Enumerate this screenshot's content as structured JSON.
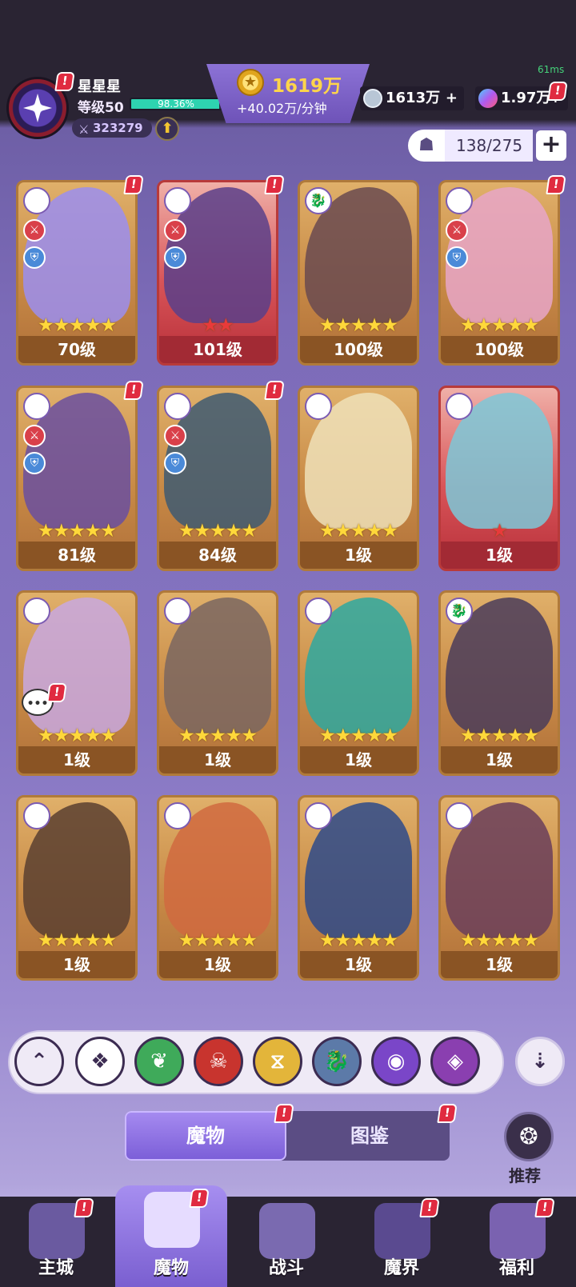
{
  "player": {
    "name": "星星星",
    "level_label": "等级50",
    "xp_percent": "98.36%",
    "xp_fraction": 0.9836,
    "power": "323279"
  },
  "gold": {
    "value": "1619万",
    "rate": "+40.02万/分钟"
  },
  "silver": {
    "value": "1613万",
    "plus": "+"
  },
  "gem": {
    "value": "1.97万",
    "plus": "+"
  },
  "ping": "61ms",
  "capacity": {
    "text": "138/275",
    "plus": "+"
  },
  "badge": "!",
  "cards": [
    {
      "level": "70级",
      "stars": "★★★★★",
      "faction": "◈",
      "frame": "gold",
      "art": "#9b8ef0"
    },
    {
      "level": "101级",
      "stars": "★★",
      "faction": "⧖",
      "frame": "red",
      "art": "#5a3f8a"
    },
    {
      "level": "100级",
      "stars": "★★★★★",
      "faction": "🐉",
      "frame": "gold",
      "art": "#6a4a50"
    },
    {
      "level": "100级",
      "stars": "★★★★★",
      "faction": "◉",
      "frame": "gold",
      "art": "#e7a6c8"
    },
    {
      "level": "81级",
      "stars": "★★★★★",
      "faction": "◉",
      "frame": "gold",
      "art": "#6a4fa0"
    },
    {
      "level": "84级",
      "stars": "★★★★★",
      "faction": "❦",
      "frame": "gold",
      "art": "#3e5a72"
    },
    {
      "level": "1级",
      "stars": "★★★★★",
      "faction": "❦",
      "frame": "gold",
      "art": "#eee0b8"
    },
    {
      "level": "1级",
      "stars": "★",
      "faction": "⧖",
      "frame": "red",
      "art": "#7cc8d8"
    },
    {
      "level": "1级",
      "stars": "★★★★★",
      "faction": "⧖",
      "frame": "gold",
      "art": "#c8a8e0"
    },
    {
      "level": "1级",
      "stars": "★★★★★",
      "faction": "◉",
      "frame": "gold",
      "art": "#7a6660"
    },
    {
      "level": "1级",
      "stars": "★★★★★",
      "faction": "◉",
      "frame": "gold",
      "art": "#2ea8a0"
    },
    {
      "level": "1级",
      "stars": "★★★★★",
      "faction": "🐉",
      "frame": "gold",
      "art": "#4a3c5a"
    },
    {
      "level": "1级",
      "stars": "★★★★★",
      "faction": "☠",
      "frame": "gold",
      "art": "#5a4030"
    },
    {
      "level": "1级",
      "stars": "★★★★★",
      "faction": "☠",
      "frame": "gold",
      "art": "#d06a40"
    },
    {
      "level": "1级",
      "stars": "★★★★★",
      "faction": "☠",
      "frame": "gold",
      "art": "#2e4a8a"
    },
    {
      "level": "1级",
      "stars": "★★★★★",
      "faction": "⧖",
      "frame": "gold",
      "art": "#6a3e5a"
    }
  ],
  "filters": [
    {
      "name": "collapse",
      "glyph": "⌃",
      "color": "#efeaf6"
    },
    {
      "name": "all",
      "glyph": "❖",
      "color": "#ffffff"
    },
    {
      "name": "nature",
      "glyph": "❦",
      "color": "#3faa5a"
    },
    {
      "name": "demon",
      "glyph": "☠",
      "color": "#c8342e"
    },
    {
      "name": "time",
      "glyph": "⧖",
      "color": "#e3b53a"
    },
    {
      "name": "dragon",
      "glyph": "🐉",
      "color": "#5c7aa8"
    },
    {
      "name": "eye",
      "glyph": "◉",
      "color": "#7a46c8"
    },
    {
      "name": "arcane",
      "glyph": "◈",
      "color": "#8a3fb0"
    }
  ],
  "sort_glyph": "⇣",
  "tabs": {
    "monster": "魔物",
    "codex": "图鉴"
  },
  "recommend": {
    "label": "推荐",
    "glyph": "❂"
  },
  "nav": [
    {
      "label": "主城",
      "color": "#6a5aa0"
    },
    {
      "label": "魔物",
      "color": "#e6dcff"
    },
    {
      "label": "战斗",
      "color": "#7a6ab0"
    },
    {
      "label": "魔界",
      "color": "#5a4a90"
    },
    {
      "label": "福利",
      "color": "#7a62b0"
    }
  ]
}
